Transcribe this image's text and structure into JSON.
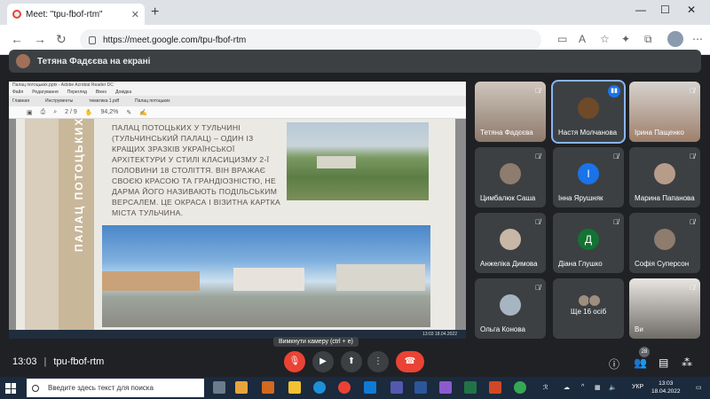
{
  "browser": {
    "tab_title": "Meet: \"tpu-fbof-rtm\"",
    "new_tab": "+",
    "url": "https://meet.google.com/tpu-fbof-rtm"
  },
  "presenter": {
    "label": "Тетяна Фадєєва на екрані"
  },
  "shared_screen": {
    "viewer_title": "Палац потоцьких.pptx - Adobe Acrobat Reader DC",
    "menu": [
      "Файл",
      "Редагування",
      "Перегляд",
      "Вікно",
      "Довідка"
    ],
    "tabs": [
      "Главная",
      "Инструменты",
      "тематика 1.pdf",
      "Палац потоцьких"
    ],
    "zoom": "94,2%",
    "page": "2 / 9",
    "slide_vertical_title": "ПАЛАЦ ПОТОЦЬКИХ",
    "slide_text": "ПАЛАЦ ПОТОЦЬКИХ У ТУЛЬЧИНІ (ТУЛЬЧИНСЬКИЙ ПАЛАЦ) – ОДИН ІЗ КРАЩИХ ЗРАЗКІВ УКРАЇНСЬКОЇ АРХІТЕКТУРИ У СТИЛІ КЛАСИЦИЗМУ 2-ї ПОЛОВИНИ 18 СТОЛІТТЯ. ВІН ВРАЖАЄ СВОЄЮ КРАСОЮ ТА ГРАНДІОЗНІСТЮ, НЕ ДАРМА ЙОГО НАЗИВАЮТЬ ПОДІЛЬСЬКИМ ВЕРСАЛЕМ. ЦЕ ОКРАСА І ВІЗИТНА КАРТКА МІСТА ТУЛЬЧИНА.",
    "inner_taskbar_clock": "13:03 18.04.2022"
  },
  "participants": [
    {
      "name": "Тетяна Фадєєва",
      "avatar_type": "video",
      "mic_muted": true
    },
    {
      "name": "Настя Молчанова",
      "avatar_type": "photo",
      "mic_muted": false,
      "speaking": true
    },
    {
      "name": "Ірина Пащенко",
      "avatar_type": "video",
      "mic_muted": true
    },
    {
      "name": "Цимбалюк Саша",
      "avatar_type": "photo",
      "mic_muted": true
    },
    {
      "name": "Інна Ярушняк",
      "avatar_type": "letter",
      "letter": "І",
      "color": "#1a73e8",
      "mic_muted": true
    },
    {
      "name": "Марина Папанова",
      "avatar_type": "photo",
      "mic_muted": true
    },
    {
      "name": "Анжеліка Димова",
      "avatar_type": "photo",
      "mic_muted": true
    },
    {
      "name": "Діана Глушко",
      "avatar_type": "letter",
      "letter": "Д",
      "color": "#137333",
      "mic_muted": true
    },
    {
      "name": "Софія Суперсон",
      "avatar_type": "photo",
      "mic_muted": true
    },
    {
      "name": "Ольга Конова",
      "avatar_type": "photo",
      "mic_muted": true
    },
    {
      "name": "Ще 16 осіб",
      "avatar_type": "more"
    },
    {
      "name": "Ви",
      "avatar_type": "video",
      "mic_muted": true
    }
  ],
  "controls": {
    "time": "13:03",
    "meeting_code": "tpu-fbof-rtm",
    "tooltip": "Вимкнути камеру (ctrl + e)",
    "participant_count": "28"
  },
  "taskbar": {
    "search_placeholder": "Введите здесь текст для поиска",
    "lang": "УКР",
    "time": "13:03",
    "date": "18.04.2022"
  },
  "colors": {
    "meet_bg": "#202124",
    "tile_bg": "#3c4043",
    "end_call": "#ea4335",
    "active_speaker": "#1a73e8"
  }
}
